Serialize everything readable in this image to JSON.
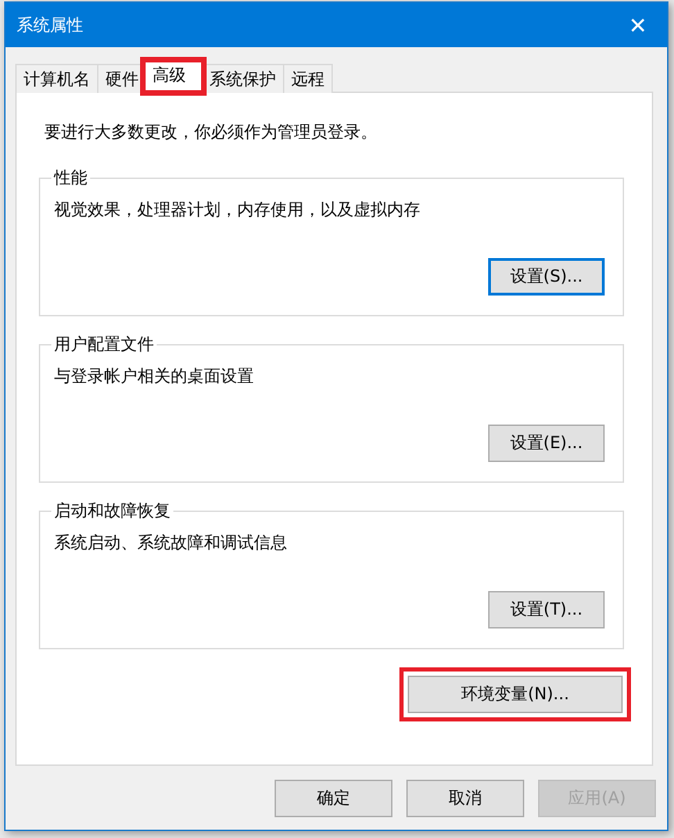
{
  "window": {
    "title": "系统属性",
    "close": "✕"
  },
  "tabs": [
    {
      "label": "计算机名",
      "selected": false,
      "highlighted": false
    },
    {
      "label": "硬件",
      "selected": false,
      "highlighted": false
    },
    {
      "label": "高级",
      "selected": true,
      "highlighted": true
    },
    {
      "label": "系统保护",
      "selected": false,
      "highlighted": false
    },
    {
      "label": "远程",
      "selected": false,
      "highlighted": false
    }
  ],
  "notice": "要进行大多数更改，你必须作为管理员登录。",
  "groups": [
    {
      "title": "性能",
      "description": "视觉效果，处理器计划，内存使用，以及虚拟内存",
      "button": {
        "label": "设置(S)...",
        "focused": true
      }
    },
    {
      "title": "用户配置文件",
      "description": "与登录帐户相关的桌面设置",
      "button": {
        "label": "设置(E)...",
        "focused": false
      }
    },
    {
      "title": "启动和故障恢复",
      "description": "系统启动、系统故障和调试信息",
      "button": {
        "label": "设置(T)...",
        "focused": false
      }
    }
  ],
  "env_button": {
    "label": "环境变量(N)...",
    "highlighted": true
  },
  "footer_buttons": [
    {
      "label": "确定",
      "disabled": false
    },
    {
      "label": "取消",
      "disabled": false
    },
    {
      "label": "应用(A)",
      "disabled": true
    }
  ]
}
